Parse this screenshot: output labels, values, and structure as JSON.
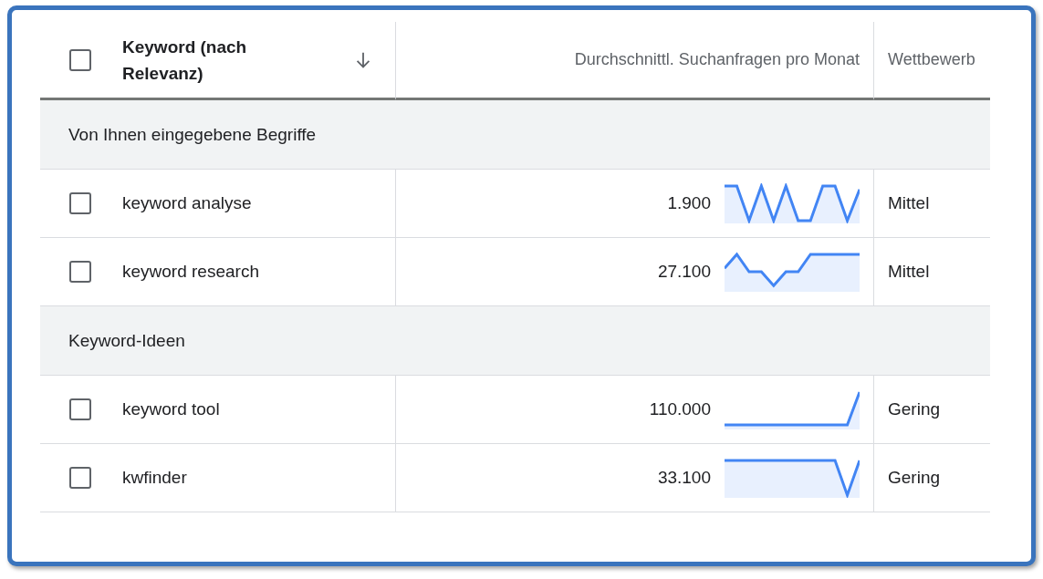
{
  "table": {
    "select_all": {
      "checked": false
    },
    "columns": [
      {
        "label": "Keyword (nach Relevanz)",
        "sorted": true
      },
      {
        "label": "Durchschnittl. Suchanfragen pro Monat"
      },
      {
        "label": "Wettbewerb"
      }
    ],
    "groups": [
      {
        "title": "Von Ihnen eingegebene Begriffe",
        "rows": [
          {
            "keyword": "keyword analyse",
            "checked": false,
            "searches": "1.900",
            "competition": "Mittel"
          },
          {
            "keyword": "keyword research",
            "checked": false,
            "searches": "27.100",
            "competition": "Mittel"
          }
        ]
      },
      {
        "title": "Keyword-Ideen",
        "rows": [
          {
            "keyword": "keyword tool",
            "checked": false,
            "searches": "110.000",
            "competition": "Gering"
          },
          {
            "keyword": "kwfinder",
            "checked": false,
            "searches": "33.100",
            "competition": "Gering"
          }
        ]
      }
    ]
  }
}
